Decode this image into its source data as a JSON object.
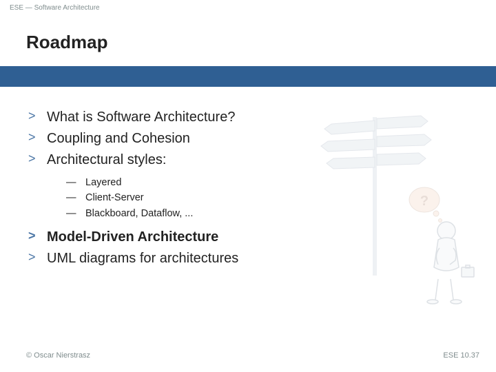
{
  "header": {
    "label": "ESE — Software Architecture"
  },
  "title": "Roadmap",
  "bullets": [
    {
      "text": "What is Software Architecture?",
      "bold": false
    },
    {
      "text": "Coupling and Cohesion",
      "bold": false
    },
    {
      "text": "Architectural styles:",
      "bold": false,
      "sub": [
        {
          "text": "Layered"
        },
        {
          "text": "Client-Server"
        },
        {
          "text": "Blackboard, Dataflow, ..."
        }
      ]
    },
    {
      "text": "Model-Driven Architecture",
      "bold": true
    },
    {
      "text": "UML diagrams for architectures",
      "bold": false
    }
  ],
  "footer": {
    "left": "© Oscar Nierstrasz",
    "right": "ESE 10.37"
  },
  "colors": {
    "band": "#2f5f93",
    "bulletMarker": "#4a75a5",
    "muted": "#7f8c8d"
  }
}
